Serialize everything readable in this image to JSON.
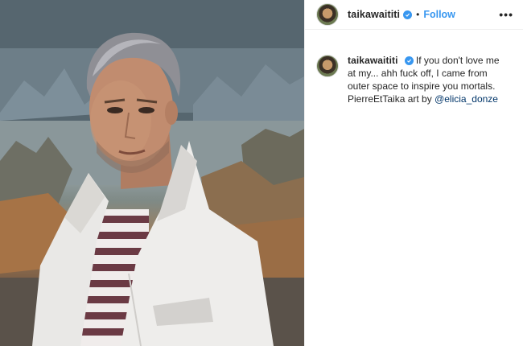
{
  "post": {
    "username": "taikawaititi",
    "separator": "•",
    "follow_label": "Follow",
    "more_icon": "•••",
    "caption": {
      "username": "taikawaititi",
      "text_line1": "If you don't love me at my... ahh fuck off, I came from outer space to inspire you mortals. PierreEtTaika art by",
      "mention": "@elicia_donze"
    }
  },
  "colors": {
    "accent": "#3897f0",
    "mention": "#003569",
    "text": "#262626",
    "border": "#efefef"
  }
}
